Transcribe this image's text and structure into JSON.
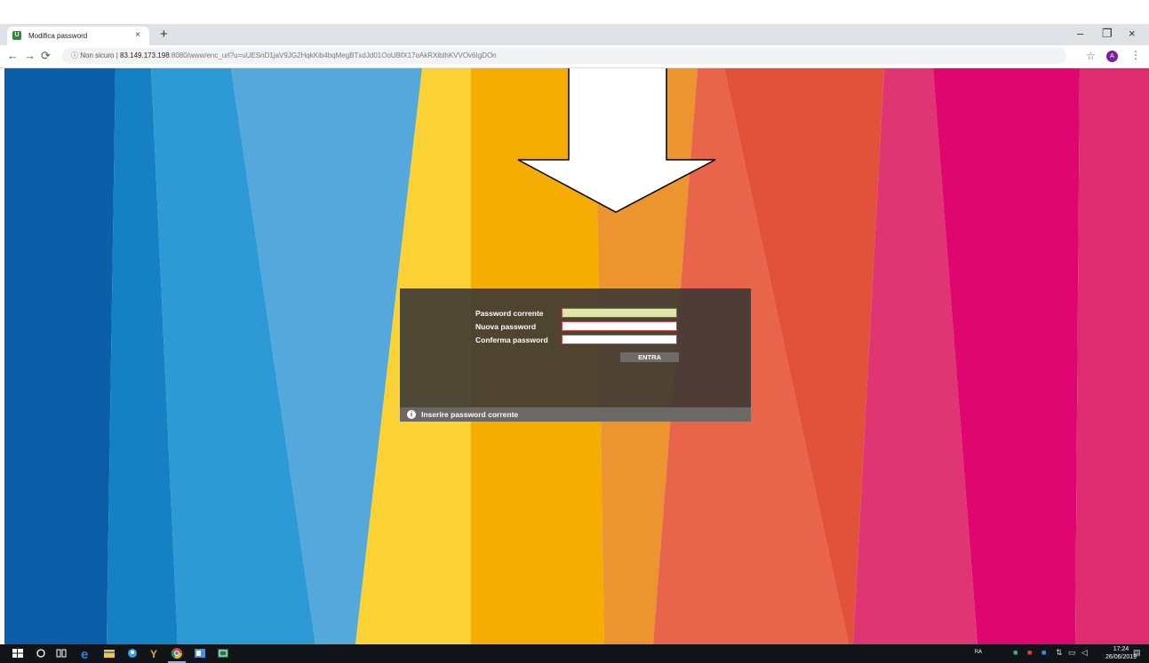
{
  "browser": {
    "tab_title": "Modifica password",
    "tab_favicon_icon": "site-favicon-icon",
    "tab_close": "×",
    "new_tab": "+",
    "win_minimize": "–",
    "win_restore": "❐",
    "win_close": "×",
    "security_label": "Non sicuro",
    "url_host": "83.149.173.198",
    "url_rest": ":8080/www/enc_url?u=uUESnD1jaV9JG2HqkKib4bqMegBTxdJd01OoUBfX17oAkRXiblhKVVOv6IgDOn",
    "profile_initial": "A"
  },
  "form": {
    "current_password_label": "Password corrente",
    "new_password_label": "Nuova password",
    "confirm_password_label": "Conferma password",
    "submit_label": "ENTRA",
    "info_message": "Inserire password corrente"
  },
  "taskbar": {
    "time": "17:24",
    "date": "26/06/2019"
  },
  "colors": {
    "panel_bg": "#3c3834",
    "focused_field": "#dfe7a8",
    "field_border": "#cc4444",
    "stripes": [
      "#0b5ea8",
      "#1580c4",
      "#2d9ad6",
      "#55a8db",
      "#fbd337",
      "#f5ad04",
      "#eb9430",
      "#e8654b",
      "#e2523a",
      "#e03573",
      "#e0066f"
    ]
  }
}
